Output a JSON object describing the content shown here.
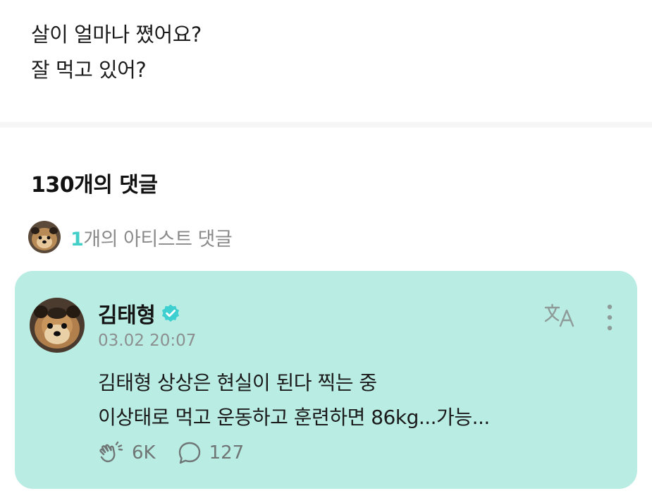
{
  "post": {
    "lines": [
      "살이 얼마나 쪘어요?",
      "잘 먹고 있어?"
    ]
  },
  "comments_header": {
    "title": "130개의 댓글"
  },
  "artist_comments": {
    "count": "1",
    "label": "개의 아티스트 댓글"
  },
  "comment": {
    "author": "김태형",
    "timestamp": "03.02 20:07",
    "lines": [
      "김태형 상상은 현실이 된다 찍는 중",
      "이상태로 먹고 운동하고 훈련하면 86kg...가능..."
    ],
    "likes": "6K",
    "replies": "127"
  },
  "colors": {
    "card_background": "#b9ece3",
    "accent": "#43cfc8",
    "verified_badge": "#3ecfd0"
  },
  "icons": {
    "translate": "translate-icon",
    "more": "more-vertical-icon",
    "like": "applause-icon",
    "reply": "speech-bubble-icon",
    "verified": "verified-badge-icon"
  }
}
